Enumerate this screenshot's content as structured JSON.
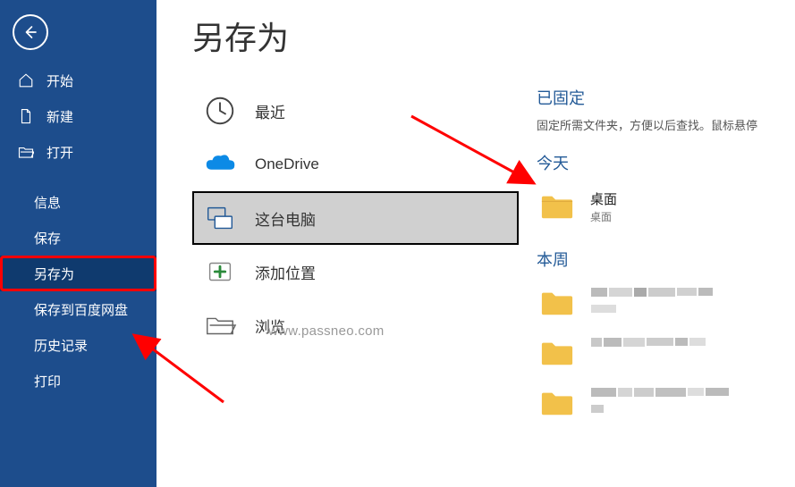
{
  "page": {
    "title": "另存为"
  },
  "sidebar": {
    "back": "返回",
    "items": [
      {
        "label": "开始",
        "icon": "home"
      },
      {
        "label": "新建",
        "icon": "new"
      },
      {
        "label": "打开",
        "icon": "open"
      }
    ],
    "subitems": [
      {
        "label": "信息"
      },
      {
        "label": "保存"
      },
      {
        "label": "另存为"
      },
      {
        "label": "保存到百度网盘"
      },
      {
        "label": "历史记录"
      },
      {
        "label": "打印"
      }
    ]
  },
  "locations": [
    {
      "label": "最近",
      "key": "recent"
    },
    {
      "label": "OneDrive",
      "key": "onedrive"
    },
    {
      "label": "这台电脑",
      "key": "thispc",
      "selected": true
    },
    {
      "label": "添加位置",
      "key": "addloc"
    },
    {
      "label": "浏览",
      "key": "browse"
    }
  ],
  "right": {
    "pinned_title": "已固定",
    "pinned_sub": "固定所需文件夹，方便以后查找。鼠标悬停",
    "today_title": "今天",
    "today_items": [
      {
        "name": "桌面",
        "path": "桌面"
      }
    ],
    "thisweek_title": "本周",
    "thisweek_items": [
      {
        "name": "",
        "path": "",
        "blurred": true
      },
      {
        "name": "",
        "path": "",
        "blurred": true
      },
      {
        "name": "",
        "path": "",
        "blurred": true
      }
    ]
  },
  "watermark": "www.passneo.com",
  "colors": {
    "sidebar": "#1d4d8c",
    "accent": "#235a97",
    "highlight": "#ff0000"
  }
}
